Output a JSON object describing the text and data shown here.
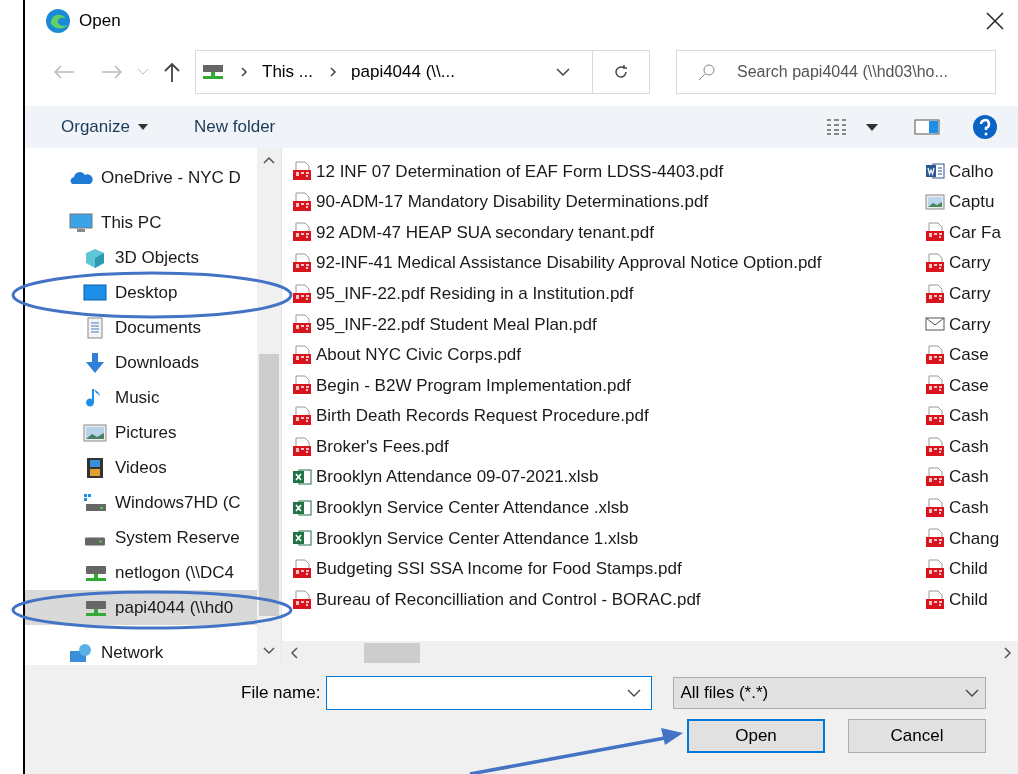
{
  "window": {
    "title": "Open"
  },
  "address_bar": {
    "crumbs": [
      "This ...",
      "papi4044 (\\\\..."
    ]
  },
  "search": {
    "placeholder": "Search papi4044 (\\\\hd03\\ho..."
  },
  "toolbar": {
    "organize": "Organize",
    "new_folder": "New folder"
  },
  "nav_pane": {
    "items": [
      {
        "label": "OneDrive - NYC D",
        "kind": "cloud",
        "selected": false
      },
      {
        "label": "This PC",
        "kind": "pc",
        "selected": false,
        "children": [
          {
            "label": "3D Objects",
            "kind": "cube",
            "selected": false
          },
          {
            "label": "Desktop",
            "kind": "desktop",
            "selected": false
          },
          {
            "label": "Documents",
            "kind": "documents",
            "selected": false
          },
          {
            "label": "Downloads",
            "kind": "downloads",
            "selected": false
          },
          {
            "label": "Music",
            "kind": "music",
            "selected": false
          },
          {
            "label": "Pictures",
            "kind": "pictures",
            "selected": false
          },
          {
            "label": "Videos",
            "kind": "videos",
            "selected": false
          },
          {
            "label": "Windows7HD (C",
            "kind": "windrive",
            "selected": false
          },
          {
            "label": "System Reserve",
            "kind": "drive",
            "selected": false
          },
          {
            "label": "netlogon (\\\\DC4",
            "kind": "netdrive",
            "selected": false
          },
          {
            "label": "papi4044 (\\\\hd0",
            "kind": "netdrive",
            "selected": true
          }
        ]
      },
      {
        "label": "Network",
        "kind": "network",
        "selected": false
      }
    ]
  },
  "files": {
    "column_1": [
      {
        "name": "12 INF 07 Determination of EAF Form LDSS-4403.pdf",
        "kind": "pdf"
      },
      {
        "name": "90-ADM-17 Mandatory Disability Determinations.pdf",
        "kind": "pdf"
      },
      {
        "name": "92 ADM-47 HEAP SUA secondary tenant.pdf",
        "kind": "pdf"
      },
      {
        "name": "92-INF-41 Medical Assistance Disability Approval Notice Option.pdf",
        "kind": "pdf"
      },
      {
        "name": "95_INF-22.pdf  Residing in a Institution.pdf",
        "kind": "pdf"
      },
      {
        "name": "95_INF-22.pdf  Student Meal Plan.pdf",
        "kind": "pdf"
      },
      {
        "name": "About NYC Civic Corps.pdf",
        "kind": "pdf"
      },
      {
        "name": "Begin - B2W Program Implementation.pdf",
        "kind": "pdf"
      },
      {
        "name": "Birth Death Records Request Procedure.pdf",
        "kind": "pdf"
      },
      {
        "name": "Broker's Fees.pdf",
        "kind": "pdf"
      },
      {
        "name": "Brooklyn Attendance  09-07-2021.xlsb",
        "kind": "excel"
      },
      {
        "name": "Brooklyn Service Center Attendance .xlsb",
        "kind": "excel"
      },
      {
        "name": "Brooklyn Service Center Attendance 1.xlsb",
        "kind": "excel"
      },
      {
        "name": "Budgeting SSI SSA Income for Food Stamps.pdf",
        "kind": "pdf"
      },
      {
        "name": "Bureau of Reconcilliation and Control - BORAC.pdf",
        "kind": "pdf"
      }
    ],
    "column_2": [
      {
        "name": "Calho",
        "kind": "word"
      },
      {
        "name": "Captu",
        "kind": "image"
      },
      {
        "name": "Car Fa",
        "kind": "pdf"
      },
      {
        "name": "Carry",
        "kind": "pdf"
      },
      {
        "name": "Carry",
        "kind": "pdf"
      },
      {
        "name": "Carry",
        "kind": "mail"
      },
      {
        "name": "Case",
        "kind": "pdf"
      },
      {
        "name": "Case",
        "kind": "pdf"
      },
      {
        "name": "Cash",
        "kind": "pdf"
      },
      {
        "name": "Cash",
        "kind": "pdf"
      },
      {
        "name": "Cash",
        "kind": "pdf"
      },
      {
        "name": "Cash",
        "kind": "pdf"
      },
      {
        "name": "Chang",
        "kind": "pdf"
      },
      {
        "name": "Child",
        "kind": "pdf"
      },
      {
        "name": "Child",
        "kind": "pdf"
      }
    ]
  },
  "file_name": {
    "label": "File name:"
  },
  "file_type": {
    "value": "All files (*.*)"
  },
  "buttons": [
    {
      "label": "Open",
      "default": true
    },
    {
      "label": "Cancel",
      "default": false
    }
  ],
  "annotations": [
    {
      "kind": "ellipse"
    },
    {
      "kind": "ellipse"
    },
    {
      "kind": "arrow"
    }
  ]
}
